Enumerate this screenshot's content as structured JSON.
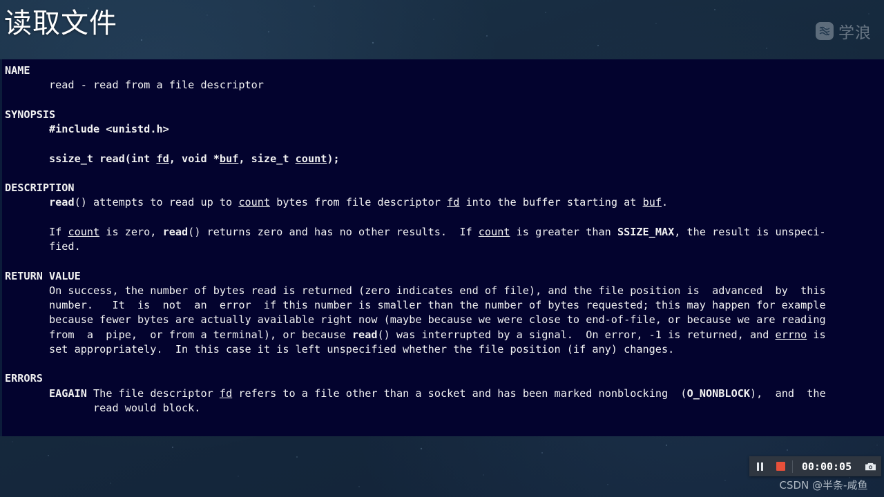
{
  "slide": {
    "title": "读取文件",
    "background_color": "#16293d"
  },
  "brand": {
    "name": "学浪",
    "icon": "wave-logo-icon"
  },
  "terminal": {
    "background_color": "#03032e",
    "text_color": "#f2f2f2",
    "manpage": [
      {
        "id": "l01",
        "segs": [
          {
            "t": "NAME",
            "s": "head"
          }
        ]
      },
      {
        "id": "l02",
        "segs": [
          {
            "t": "       read - read from a file descriptor",
            "s": ""
          }
        ]
      },
      {
        "id": "l03",
        "segs": [
          {
            "t": "",
            "s": ""
          }
        ]
      },
      {
        "id": "l04",
        "segs": [
          {
            "t": "SYNOPSIS",
            "s": "head"
          }
        ]
      },
      {
        "id": "l05",
        "segs": [
          {
            "t": "       ",
            "s": ""
          },
          {
            "t": "#include <unistd.h>",
            "s": "b"
          }
        ]
      },
      {
        "id": "l06",
        "segs": [
          {
            "t": "",
            "s": ""
          }
        ]
      },
      {
        "id": "l07",
        "segs": [
          {
            "t": "       ",
            "s": ""
          },
          {
            "t": "ssize_t read(int ",
            "s": "b"
          },
          {
            "t": "fd",
            "s": "bu"
          },
          {
            "t": ", void *",
            "s": "b"
          },
          {
            "t": "buf",
            "s": "bu"
          },
          {
            "t": ", size_t ",
            "s": "b"
          },
          {
            "t": "count",
            "s": "bu"
          },
          {
            "t": ");",
            "s": "b"
          }
        ]
      },
      {
        "id": "l08",
        "segs": [
          {
            "t": "",
            "s": ""
          }
        ]
      },
      {
        "id": "l09",
        "segs": [
          {
            "t": "DESCRIPTION",
            "s": "head"
          }
        ]
      },
      {
        "id": "l10",
        "segs": [
          {
            "t": "       ",
            "s": ""
          },
          {
            "t": "read",
            "s": "b"
          },
          {
            "t": "() attempts to read up to ",
            "s": ""
          },
          {
            "t": "count",
            "s": "u"
          },
          {
            "t": " bytes from file descriptor ",
            "s": ""
          },
          {
            "t": "fd",
            "s": "u"
          },
          {
            "t": " into the buffer starting at ",
            "s": ""
          },
          {
            "t": "buf",
            "s": "u"
          },
          {
            "t": ".",
            "s": ""
          }
        ]
      },
      {
        "id": "l11",
        "segs": [
          {
            "t": "",
            "s": ""
          }
        ]
      },
      {
        "id": "l12",
        "segs": [
          {
            "t": "       If ",
            "s": ""
          },
          {
            "t": "count",
            "s": "u"
          },
          {
            "t": " is zero, ",
            "s": ""
          },
          {
            "t": "read",
            "s": "b"
          },
          {
            "t": "() returns zero and has no other results.  If ",
            "s": ""
          },
          {
            "t": "count",
            "s": "u"
          },
          {
            "t": " is greater than ",
            "s": ""
          },
          {
            "t": "SSIZE_MAX",
            "s": "b"
          },
          {
            "t": ", the result is unspeci-",
            "s": ""
          }
        ]
      },
      {
        "id": "l13",
        "segs": [
          {
            "t": "       fied.",
            "s": ""
          }
        ]
      },
      {
        "id": "l14",
        "segs": [
          {
            "t": "",
            "s": ""
          }
        ]
      },
      {
        "id": "l15",
        "segs": [
          {
            "t": "RETURN VALUE",
            "s": "head"
          }
        ]
      },
      {
        "id": "l16",
        "segs": [
          {
            "t": "       On success, the number of bytes read is returned (zero indicates end of file), and the file position is  advanced  by  this",
            "s": ""
          }
        ]
      },
      {
        "id": "l17",
        "segs": [
          {
            "t": "       number.   It  is  not  an  error  if this number is smaller than the number of bytes requested; this may happen for example",
            "s": ""
          }
        ]
      },
      {
        "id": "l18",
        "segs": [
          {
            "t": "       because fewer bytes are actually available right now (maybe because we were close to end-of-file, or because we are reading",
            "s": ""
          }
        ]
      },
      {
        "id": "l19",
        "segs": [
          {
            "t": "       from  a  pipe,  or from a terminal), or because ",
            "s": ""
          },
          {
            "t": "read",
            "s": "b"
          },
          {
            "t": "() was interrupted by a signal.  On error, -1 is returned, and ",
            "s": ""
          },
          {
            "t": "errno",
            "s": "u"
          },
          {
            "t": " is",
            "s": ""
          }
        ]
      },
      {
        "id": "l20",
        "segs": [
          {
            "t": "       set appropriately.  In this case it is left unspecified whether the file position (if any) changes.",
            "s": ""
          }
        ]
      },
      {
        "id": "l21",
        "segs": [
          {
            "t": "",
            "s": ""
          }
        ]
      },
      {
        "id": "l22",
        "segs": [
          {
            "t": "ERRORS",
            "s": "head"
          }
        ]
      },
      {
        "id": "l23",
        "segs": [
          {
            "t": "       ",
            "s": ""
          },
          {
            "t": "EAGAIN",
            "s": "b"
          },
          {
            "t": " The file descriptor ",
            "s": ""
          },
          {
            "t": "fd",
            "s": "u"
          },
          {
            "t": " refers to a file other than a socket and has been marked nonblocking  (",
            "s": ""
          },
          {
            "t": "O_NONBLOCK",
            "s": "b"
          },
          {
            "t": "),  and  the",
            "s": ""
          }
        ]
      },
      {
        "id": "l24",
        "segs": [
          {
            "t": "              read would block.",
            "s": ""
          }
        ]
      }
    ]
  },
  "recorder": {
    "pause_label": "pause-recording",
    "stop_label": "stop-recording",
    "timer": "00:00:05",
    "camera_label": "screenshot",
    "stop_color": "#e8503a",
    "bar_color": "#2f3640"
  },
  "watermark": {
    "csdn": "CSDN @半条-咸鱼"
  }
}
